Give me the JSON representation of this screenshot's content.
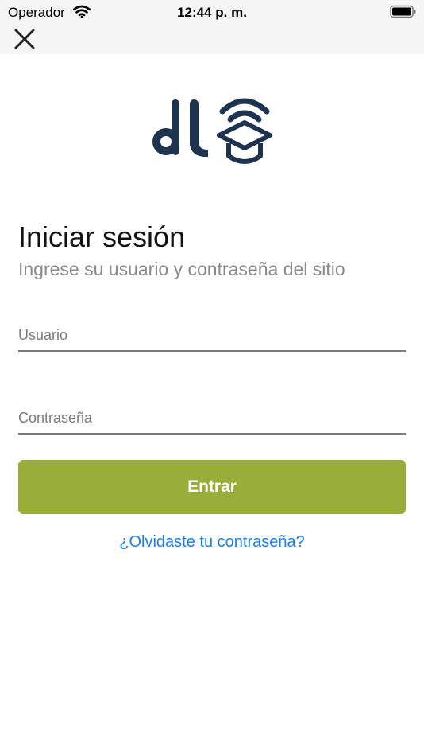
{
  "status_bar": {
    "carrier": "Operador",
    "time": "12:44 p. m.",
    "wifi_icon": "wifi-icon",
    "battery_icon": "battery-icon"
  },
  "nav": {
    "close_icon": "close-icon"
  },
  "logo": {
    "text": "dl",
    "icon": "graduation-cap-wifi-icon",
    "color": "#1d3350"
  },
  "login": {
    "title": "Iniciar sesión",
    "subtitle": "Ingrese su usuario y contraseña del sitio",
    "username_placeholder": "Usuario",
    "username_value": "",
    "password_placeholder": "Contraseña",
    "password_value": "",
    "submit_label": "Entrar",
    "forgot_label": "¿Olvidaste tu contraseña?"
  },
  "colors": {
    "accent": "#98ad3a",
    "link": "#1a7ff0",
    "logo": "#1d3350"
  }
}
